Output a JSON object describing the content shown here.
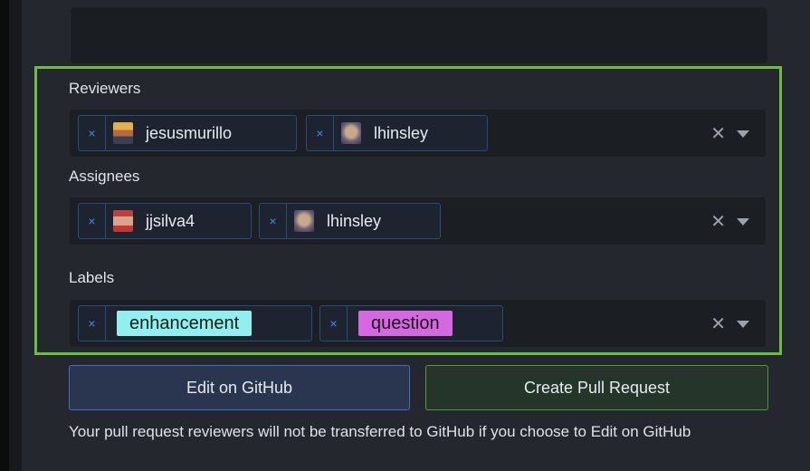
{
  "reviewers": {
    "label": "Reviewers",
    "chips": [
      {
        "name": "jesusmurillo"
      },
      {
        "name": "lhinsley"
      }
    ]
  },
  "assignees": {
    "label": "Assignees",
    "chips": [
      {
        "name": "jjsilva4"
      },
      {
        "name": "lhinsley"
      }
    ]
  },
  "labels": {
    "label": "Labels",
    "chips": [
      {
        "name": "enhancement",
        "color": "#8ff0ee"
      },
      {
        "name": "question",
        "color": "#d568e0"
      }
    ]
  },
  "glyphs": {
    "remove": "×",
    "clear": "✕"
  },
  "buttons": {
    "edit_label": "Edit on GitHub",
    "create_label": "Create Pull Request"
  },
  "note": "Your pull request reviewers will not be transferred to GitHub if you choose to Edit on GitHub",
  "colors": {
    "highlight_border": "#6cbe3e",
    "remove_x": "#3d8bff"
  }
}
